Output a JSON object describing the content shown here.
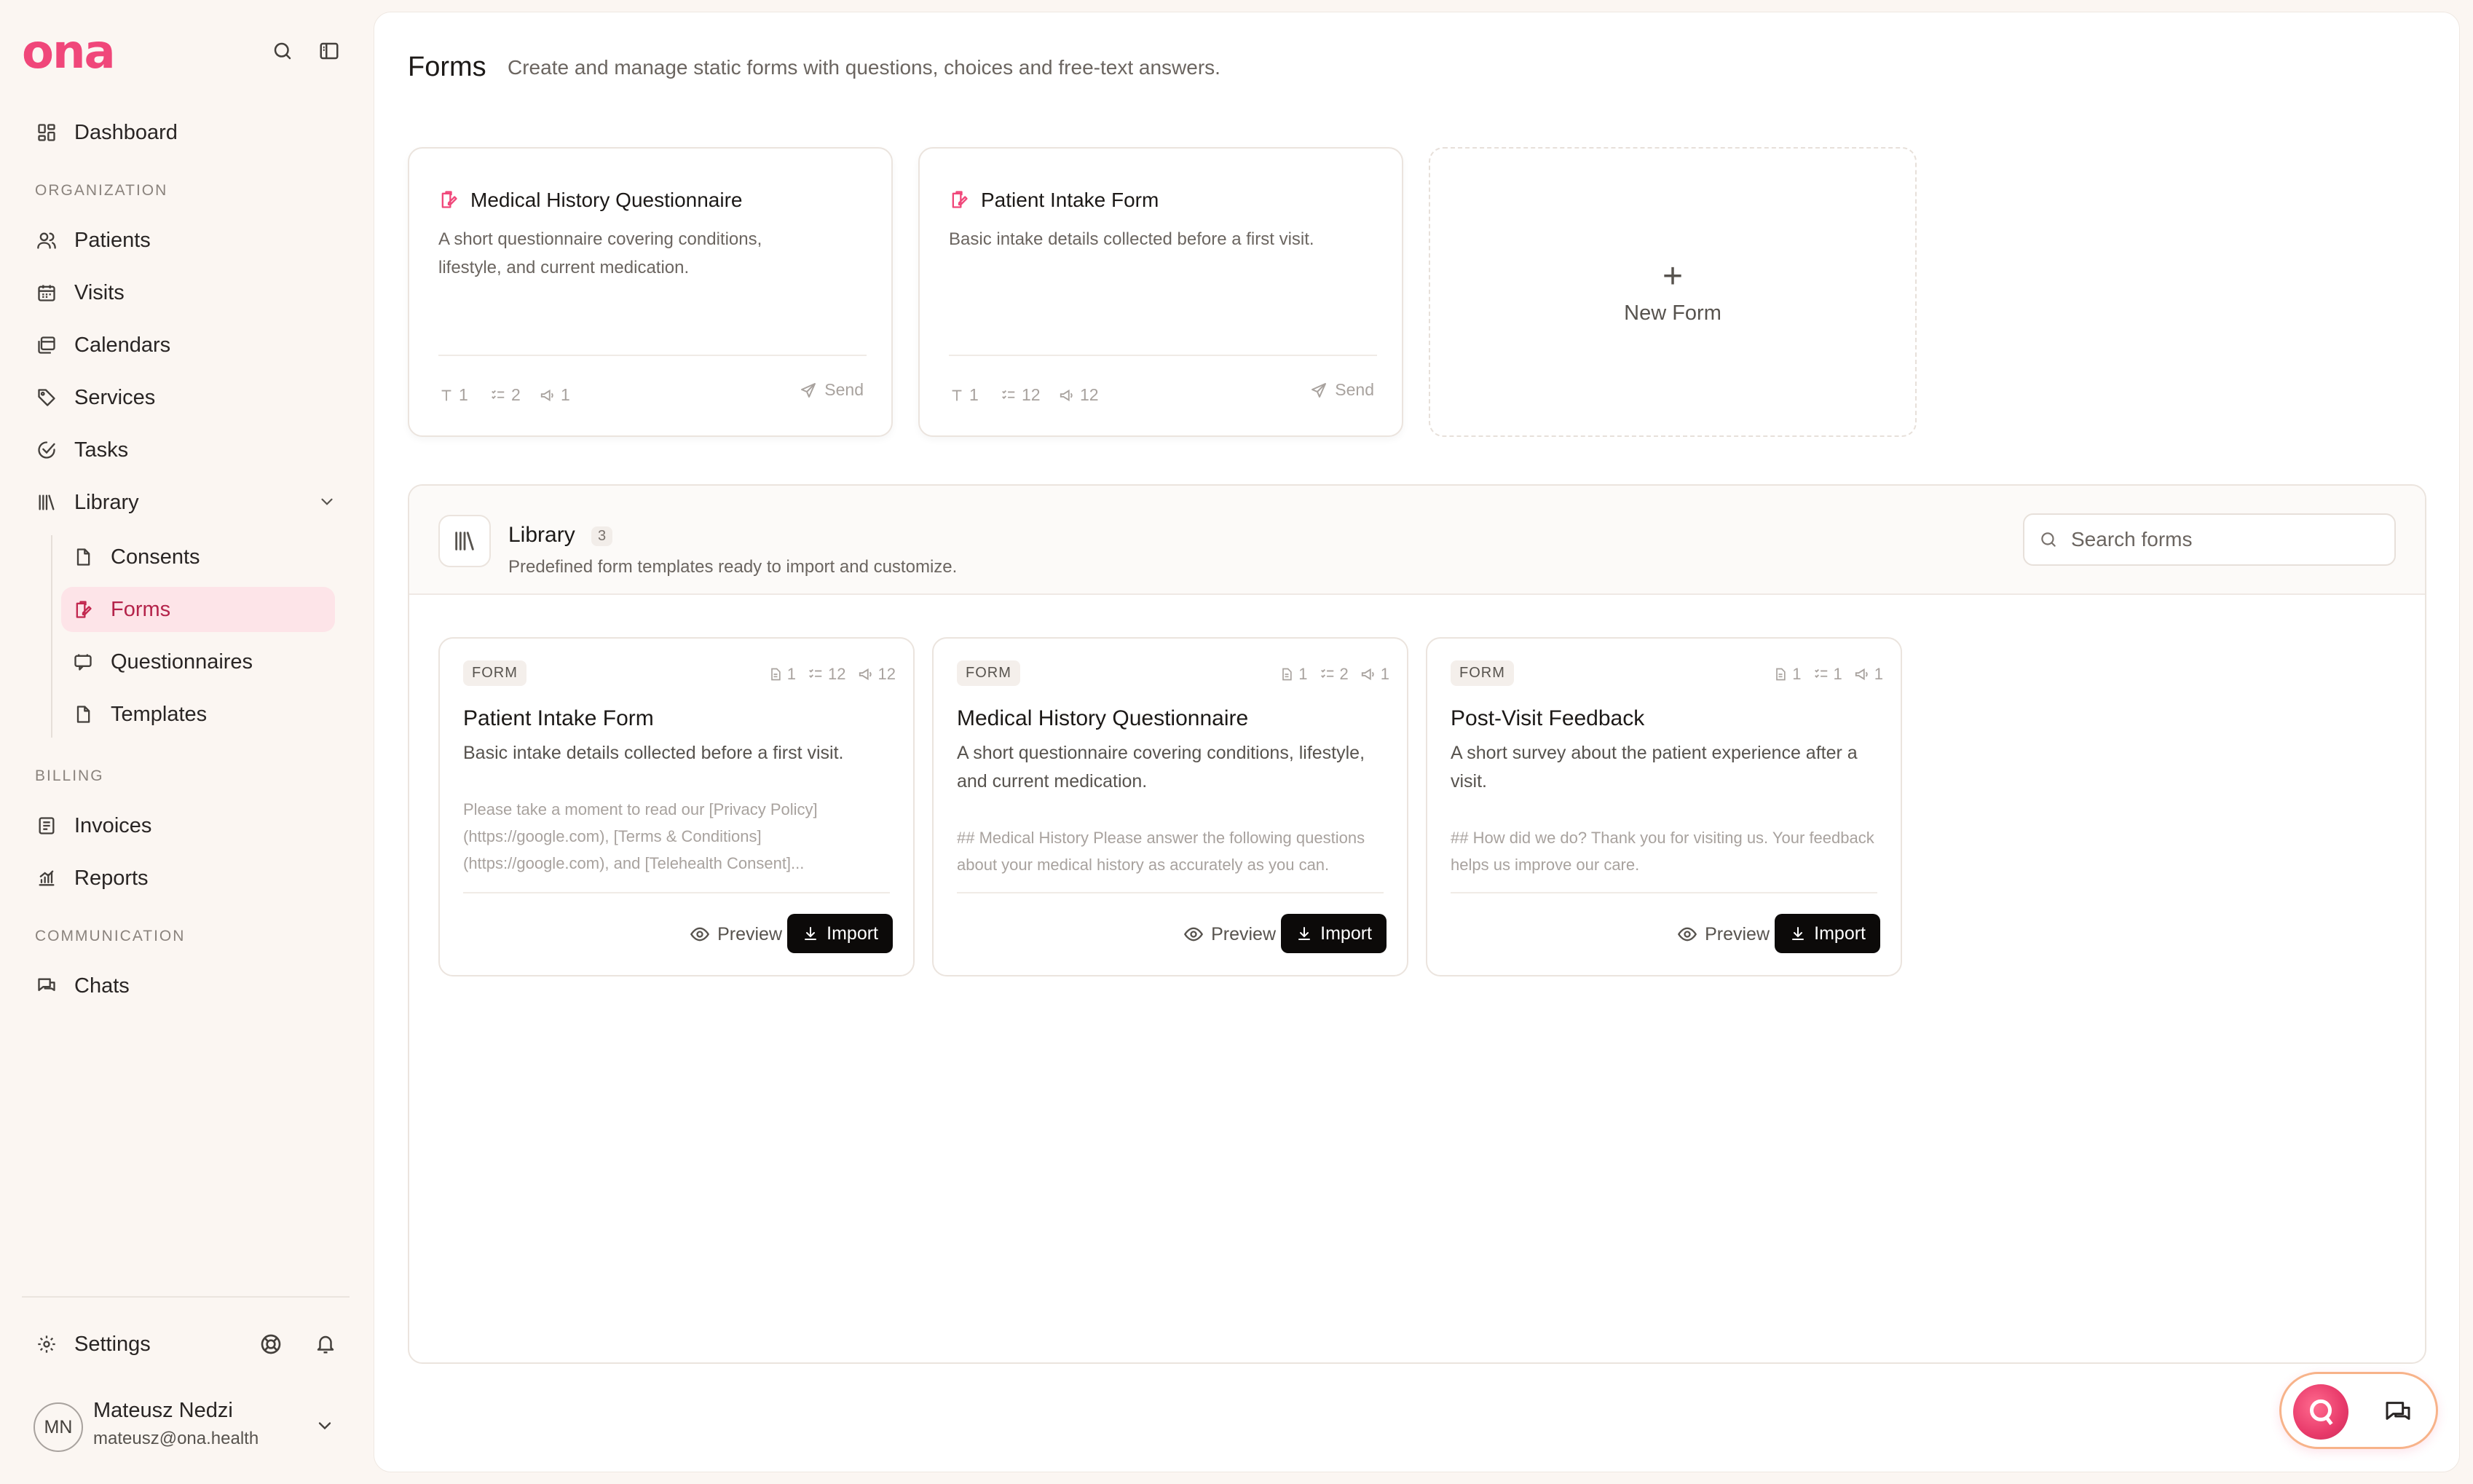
{
  "app": {
    "logo": "ona"
  },
  "sidebar": {
    "dashboard": "Dashboard",
    "sections": {
      "organization": "ORGANIZATION",
      "billing": "BILLING",
      "communication": "COMMUNICATION"
    },
    "items": {
      "patients": "Patients",
      "visits": "Visits",
      "calendars": "Calendars",
      "services": "Services",
      "tasks": "Tasks",
      "library": "Library",
      "consents": "Consents",
      "forms": "Forms",
      "questionnaires": "Questionnaires",
      "templates": "Templates",
      "invoices": "Invoices",
      "reports": "Reports",
      "chats": "Chats",
      "settings": "Settings"
    },
    "active_item": "forms",
    "user": {
      "initials": "MN",
      "name": "Mateusz Nedzi",
      "email": "mateusz@ona.health"
    }
  },
  "header": {
    "title": "Forms",
    "description": "Create and manage static forms with questions, choices and free-text answers."
  },
  "forms": [
    {
      "title": "Medical History Questionnaire",
      "description": "A short questionnaire covering conditions, lifestyle, and current medication.",
      "stats": {
        "text": "1",
        "choices": "2",
        "statements": "1"
      },
      "send_label": "Send"
    },
    {
      "title": "Patient Intake Form",
      "description": "Basic intake details collected before a first visit.",
      "stats": {
        "text": "1",
        "choices": "12",
        "statements": "12"
      },
      "send_label": "Send"
    }
  ],
  "new_form_label": "New Form",
  "library": {
    "title": "Library",
    "count": "3",
    "description": "Predefined form templates ready to import and customize.",
    "search_placeholder": "Search forms",
    "templates": [
      {
        "badge": "FORM",
        "stats": {
          "docs": "1",
          "choices": "12",
          "statements": "12"
        },
        "title": "Patient Intake Form",
        "description": "Basic intake details collected before a first visit.",
        "body": "Please take a moment to read our [Privacy Policy](https://google.com), [Terms & Conditions](https://google.com), and [Telehealth Consent]...",
        "preview_label": "Preview",
        "import_label": "Import"
      },
      {
        "badge": "FORM",
        "stats": {
          "docs": "1",
          "choices": "2",
          "statements": "1"
        },
        "title": "Medical History Questionnaire",
        "description": "A short questionnaire covering conditions, lifestyle, and current medication.",
        "body": "## Medical History Please answer the following questions about your medical history as accurately as you can.",
        "preview_label": "Preview",
        "import_label": "Import"
      },
      {
        "badge": "FORM",
        "stats": {
          "docs": "1",
          "choices": "1",
          "statements": "1"
        },
        "title": "Post-Visit Feedback",
        "description": "A short survey about the patient experience after a visit.",
        "body": "## How did we do? Thank you for visiting us. Your feedback helps us improve our care.",
        "preview_label": "Preview",
        "import_label": "Import"
      }
    ]
  },
  "colors": {
    "brand": "#f0477a",
    "active_bg": "#fde4e8",
    "active_text": "#b4234a",
    "import_bg": "#0c0a09"
  }
}
